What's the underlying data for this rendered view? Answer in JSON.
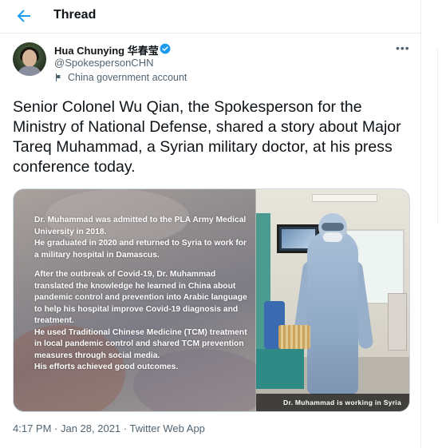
{
  "header": {
    "title": "Thread",
    "back_icon": "arrow-left-icon",
    "accent": "#1d9bf0"
  },
  "author": {
    "name": "Hua Chunying 华春莹",
    "handle": "@SpokespersonCHN",
    "label": "China government account",
    "verified": true
  },
  "tweet": {
    "text": "Senior Colonel Wu Qian, the Spokesperson for the Ministry of National Defense, shared a story about Major Tareq Muhammad, a Syrian military doctor, at his press conference today."
  },
  "media": {
    "paragraph1": "Dr. Muhammad was admitted to the PLA Army Medical University in 2018.\nHe graduated in 2020 and returned to Syria to work for a military hospital in Damascus.",
    "paragraph2": "After the outbreak of Covid-19, Dr. Muhammad translated the knowledge he learned in China about pandemic control and prevention into Arabic language to help his hospital improve Covid-19 diagnosis and treatment.\nHe used Traditional Chinese Medicine (TCM) treatment in local pandemic control and shared TCM prevention measures through social media.\nHis efforts achieved good outcomes.",
    "caption": "Dr. Muhammad is working in Syria"
  },
  "meta": {
    "time": "4:17 PM",
    "separator1": " · ",
    "date": "Jan 28, 2021",
    "separator2": " · ",
    "source": "Twitter Web App"
  }
}
